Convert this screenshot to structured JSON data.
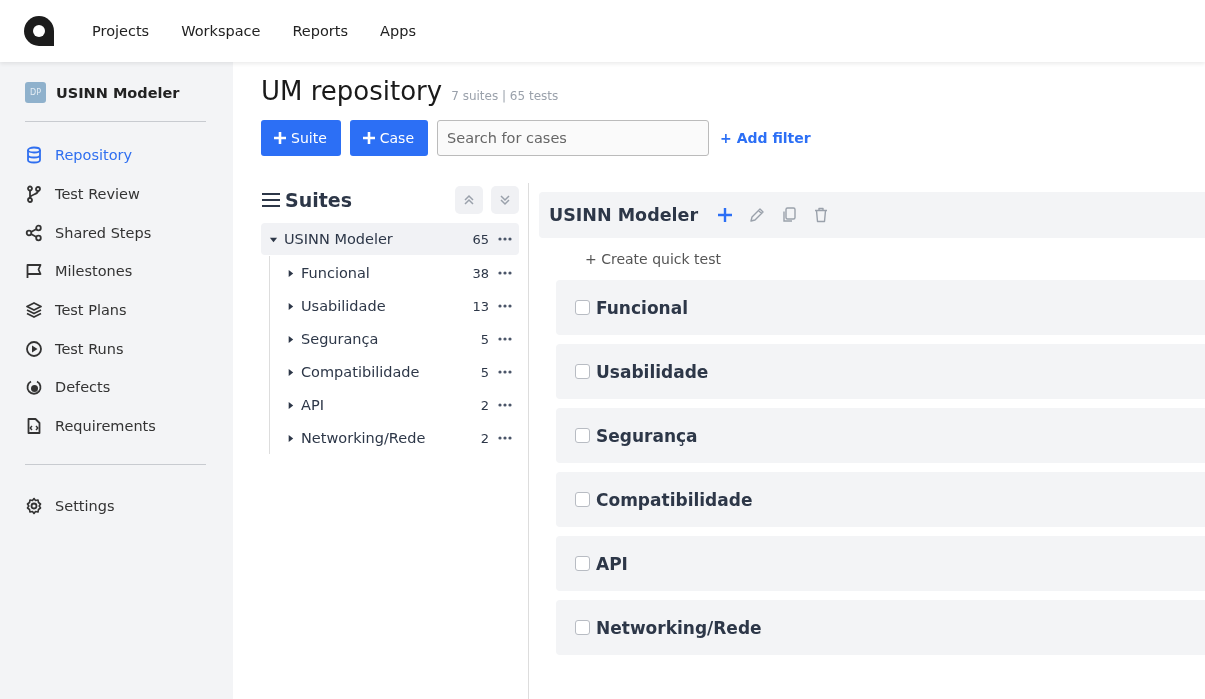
{
  "top_nav": {
    "items": [
      {
        "label": "Projects"
      },
      {
        "label": "Workspace"
      },
      {
        "label": "Reports"
      },
      {
        "label": "Apps"
      }
    ]
  },
  "sidebar": {
    "project": {
      "badge": "DP",
      "name": "USINN Modeler"
    },
    "items": [
      {
        "label": "Repository",
        "selected": true
      },
      {
        "label": "Test Review",
        "selected": false
      },
      {
        "label": "Shared Steps",
        "selected": false
      },
      {
        "label": "Milestones",
        "selected": false
      },
      {
        "label": "Test Plans",
        "selected": false
      },
      {
        "label": "Test Runs",
        "selected": false
      },
      {
        "label": "Defects",
        "selected": false
      },
      {
        "label": "Requirements",
        "selected": false
      }
    ],
    "footer_items": [
      {
        "label": "Settings",
        "selected": false
      }
    ]
  },
  "header": {
    "title": "UM repository",
    "summary": "7 suites | 65 tests"
  },
  "toolbar": {
    "buttons": [
      "Suite",
      "Case"
    ],
    "search": {
      "placeholder": "Search for cases"
    },
    "filter_link": "+ Add filter"
  },
  "suites_panel": {
    "title": "Suites",
    "tree": [
      {
        "name": "USINN Modeler",
        "count": "65",
        "expanded": true,
        "selected": true,
        "children": [
          {
            "name": "Funcional",
            "count": "38",
            "expanded": false,
            "selected": false
          },
          {
            "name": "Usabilidade",
            "count": "13",
            "expanded": false,
            "selected": false
          },
          {
            "name": "Segurança",
            "count": "5",
            "expanded": false,
            "selected": false
          },
          {
            "name": "Compatibilidade",
            "count": "5",
            "expanded": false,
            "selected": false
          },
          {
            "name": "API",
            "count": "2",
            "expanded": false,
            "selected": false
          },
          {
            "name": "Networking/Rede",
            "count": "2",
            "expanded": false,
            "selected": false
          }
        ]
      }
    ]
  },
  "detail": {
    "title": "USINN Modeler",
    "quick_test": "+ Create quick test",
    "suites": [
      {
        "name": "Funcional",
        "checked": false
      },
      {
        "name": "Usabilidade",
        "checked": false
      },
      {
        "name": "Segurança",
        "checked": false
      },
      {
        "name": "Compatibilidade",
        "checked": false
      },
      {
        "name": "API",
        "checked": false
      },
      {
        "name": "Networking/Rede",
        "checked": false
      }
    ]
  }
}
